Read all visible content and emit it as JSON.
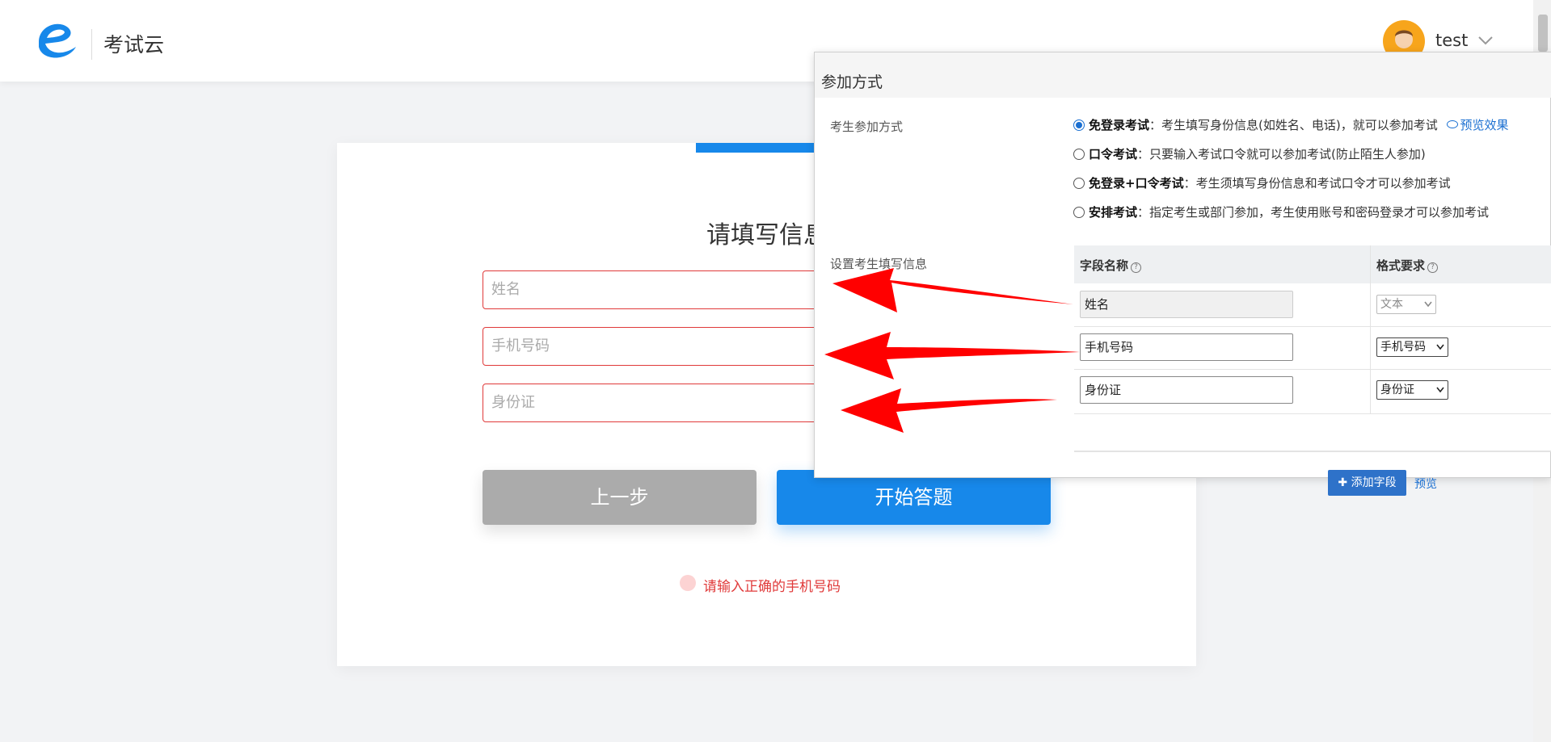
{
  "header": {
    "app_title": "考试云",
    "username": "test"
  },
  "form": {
    "title": "请填写信息",
    "inputs": [
      {
        "placeholder": "姓名"
      },
      {
        "placeholder": "手机号码"
      },
      {
        "placeholder": "身份证"
      }
    ],
    "prev_label": "上一步",
    "start_label": "开始答题",
    "error_text": "请输入正确的手机号码"
  },
  "panel": {
    "title": "参加方式",
    "join_label": "考生参加方式",
    "options": [
      {
        "name": "免登录考试",
        "desc": "：考生填写身份信息(如姓名、电话)，就可以参加考试",
        "selected": true,
        "preview": "预览效果"
      },
      {
        "name": "口令考试",
        "desc": "：只要输入考试口令就可以参加考试(防止陌生人参加)",
        "selected": false
      },
      {
        "name": "免登录+口令考试",
        "desc": "：考生须填写身份信息和考试口令才可以参加考试",
        "selected": false
      },
      {
        "name": "安排考试",
        "desc": "：指定考生或部门参加，考生使用账号和密码登录才可以参加考试",
        "selected": false
      }
    ],
    "fields_label": "设置考生填写信息",
    "table": {
      "col_field": "字段名称",
      "col_format": "格式要求",
      "rows": [
        {
          "field": "姓名",
          "format": "文本",
          "disabled": true
        },
        {
          "field": "手机号码",
          "format": "手机号码",
          "disabled": false
        },
        {
          "field": "身份证",
          "format": "身份证",
          "disabled": false
        }
      ],
      "add_label": "添加字段",
      "preview_label": "预览"
    }
  },
  "colors": {
    "primary": "#1788ea",
    "error": "#e03a3a",
    "arrow": "#ff0000"
  }
}
